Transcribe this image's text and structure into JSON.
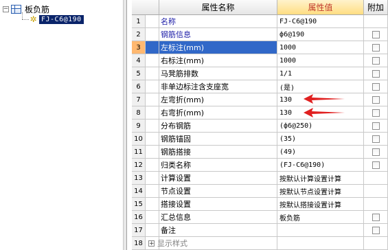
{
  "tree": {
    "root_label": "板负筋",
    "selected_item": "FJ-C6@190"
  },
  "grid": {
    "headers": {
      "name": "属性名称",
      "value": "属性值",
      "extra": "附加"
    },
    "rows": [
      {
        "num": "1",
        "name": "名称",
        "value": "FJ-C6@190",
        "blue": true,
        "checkbox": false
      },
      {
        "num": "2",
        "name": "钢筋信息",
        "value": "ф6@190",
        "blue": true,
        "checkbox": true
      },
      {
        "num": "3",
        "name": "左标注(mm)",
        "value": "1000",
        "selected": true,
        "checkbox": true
      },
      {
        "num": "4",
        "name": "右标注(mm)",
        "value": "1000",
        "checkbox": true
      },
      {
        "num": "5",
        "name": "马凳筋排数",
        "value": "1/1",
        "checkbox": true
      },
      {
        "num": "6",
        "name": "非单边标注含支座宽",
        "value": "(是)",
        "checkbox": true
      },
      {
        "num": "7",
        "name": "左弯折(mm)",
        "value": "130",
        "checkbox": true
      },
      {
        "num": "8",
        "name": "右弯折(mm)",
        "value": "130",
        "checkbox": true
      },
      {
        "num": "9",
        "name": "分布钢筋",
        "value": "(ф6@250)",
        "checkbox": true
      },
      {
        "num": "10",
        "name": "钢筋锚固",
        "value": "(35)",
        "checkbox": true
      },
      {
        "num": "11",
        "name": "钢筋搭接",
        "value": "(49)",
        "checkbox": true
      },
      {
        "num": "12",
        "name": "归类名称",
        "value": "(FJ-C6@190)",
        "checkbox": true
      },
      {
        "num": "13",
        "name": "计算设置",
        "value": "按默认计算设置计算",
        "checkbox": false
      },
      {
        "num": "14",
        "name": "节点设置",
        "value": "按默认节点设置计算",
        "checkbox": false
      },
      {
        "num": "15",
        "name": "搭接设置",
        "value": "按默认搭接设置计算",
        "checkbox": false
      },
      {
        "num": "16",
        "name": "汇总信息",
        "value": "板负筋",
        "checkbox": true
      },
      {
        "num": "17",
        "name": "备注",
        "value": "",
        "checkbox": true
      },
      {
        "num": "18",
        "name": "显示样式",
        "value": "",
        "checkbox": false,
        "expandable": true,
        "gray": true
      }
    ]
  },
  "annotations": {
    "arrow_color": "#e02020"
  }
}
